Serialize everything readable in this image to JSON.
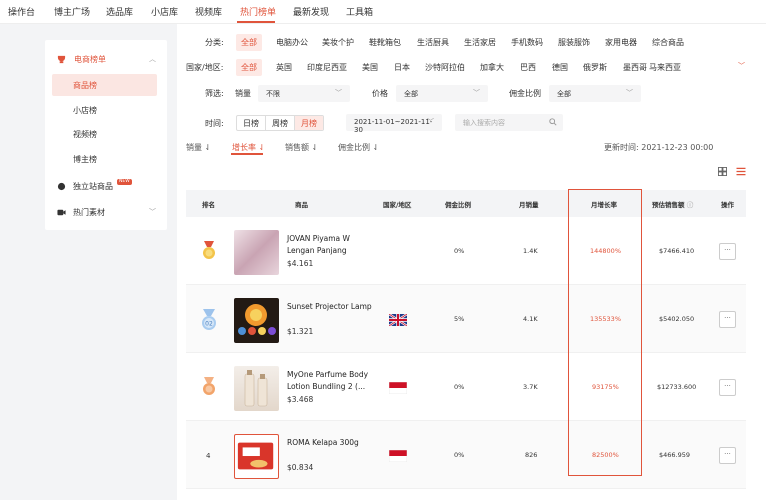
{
  "nav": {
    "items": [
      "操作台",
      "博主广场",
      "选品库",
      "小店库",
      "视频库",
      "热门榜单",
      "最新发现",
      "工具箱"
    ],
    "active": "热门榜单"
  },
  "sidebar": {
    "section_title": "电商榜单",
    "items": [
      {
        "label": "商品榜",
        "active": true
      },
      {
        "label": "小店榜"
      },
      {
        "label": "视频榜"
      },
      {
        "label": "博主榜"
      }
    ],
    "independent_label": "独立站商品",
    "new_badge": "NEW",
    "materials_label": "热门素材"
  },
  "filters": {
    "category_label": "分类:",
    "categories": [
      "全部",
      "电脑办公",
      "美妆个护",
      "鞋靴箱包",
      "生活厨具",
      "生活家居",
      "手机数码",
      "服装服饰",
      "家用电器",
      "综合商品"
    ],
    "region_label": "国家/地区:",
    "regions": [
      "全部",
      "英国",
      "印度尼西亚",
      "美国",
      "日本",
      "沙特阿拉伯",
      "加拿大",
      "巴西",
      "德国",
      "俄罗斯",
      "墨西哥",
      "马来西亚"
    ],
    "screen_label": "筛选:",
    "sales_label": "销量",
    "sales_value": "不限",
    "price_label": "价格",
    "price_value": "全部",
    "commission_label": "佣金比例",
    "commission_value": "全部",
    "time_label": "时间:",
    "time_tabs": [
      "日榜",
      "周榜",
      "月榜"
    ],
    "time_active": "月榜",
    "date_range": "2021-11-01~2021-11-30",
    "search_placeholder": "输入搜索内容"
  },
  "sort": {
    "tabs": [
      "销量",
      "增长率",
      "销售额",
      "佣金比例"
    ],
    "active": "增长率",
    "update_time": "更新时间: 2021-12-23 00:00"
  },
  "table": {
    "headers": [
      "排名",
      "商品",
      "国家/地区",
      "佣金比例",
      "月销量",
      "月增长率",
      "预估销售额",
      "操作"
    ],
    "rows": [
      {
        "rank": "1",
        "name": "JOVAN Piyama W Lengan Panjang",
        "price": "$4.161",
        "flag": "",
        "commission": "0%",
        "sales": "1.4K",
        "growth": "144800%",
        "revenue": "$7466.410",
        "more": "···"
      },
      {
        "rank": "02",
        "name": "Sunset Projector Lamp",
        "price": "$1.321",
        "flag": "uk-flag-icon",
        "commission": "5%",
        "sales": "4.1K",
        "growth": "135533%",
        "revenue": "$5402.050",
        "more": "···"
      },
      {
        "rank": "3",
        "name": "MyOne Parfume Body Lotion Bundling 2 (...",
        "price": "$3.468",
        "flag": "indonesia-flag-icon",
        "commission": "0%",
        "sales": "3.7K",
        "growth": "93175%",
        "revenue": "$12733.600",
        "more": "···"
      },
      {
        "rank": "4",
        "name": "ROMA Kelapa 300g",
        "price": "$0.834",
        "flag": "indonesia-flag-icon",
        "commission": "0%",
        "sales": "826",
        "growth": "82500%",
        "revenue": "$466.959",
        "more": "···"
      }
    ]
  },
  "colors": {
    "accent": "#e0543b",
    "highlight_bg": "#fde9e5"
  }
}
